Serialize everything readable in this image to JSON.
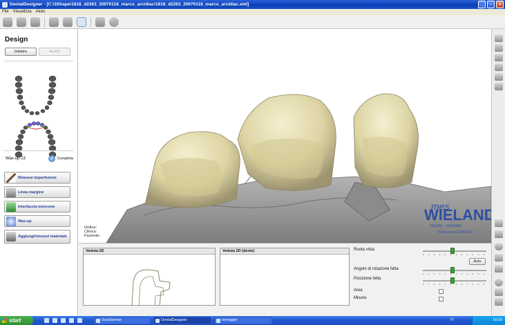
{
  "window": {
    "title": "DentalDesigner - [C:\\3Shape\\1818_d2263_20070118_marco_arcidiac\\1818_d2263_20070118_marco_arcidiac.xml]",
    "buttons": [
      "_",
      "▫",
      "×"
    ]
  },
  "menu": [
    "File",
    "Visualizza",
    "Aiuto"
  ],
  "left_panel": {
    "title": "Design",
    "back_label": "Indietro",
    "next_label": "Avanti",
    "tooth_label": "Wax-up 23",
    "complete_label": "Completa",
    "steps": [
      {
        "label": "Rimuovi imperfezioni"
      },
      {
        "label": "Linea margine"
      },
      {
        "label": "Interfaccia moncone"
      },
      {
        "label": "Wax-up"
      },
      {
        "label": "Aggiungi/rimuovi materiale"
      }
    ]
  },
  "viewport": {
    "info": [
      "Ordine:",
      "Clinica:",
      "Paziente:"
    ],
    "watermark": {
      "brand": "WIELAND",
      "prefix": "mes",
      "tagline": "DENTAL · CERAMIC",
      "sub": "Produzione CAD/CAM"
    }
  },
  "bottom": {
    "view2d_title": "Veduta 2D",
    "view2d_antag_title": "Veduta 2D (dente)",
    "controls": {
      "rotate_label": "Ruota vista",
      "auto_label": "Auto",
      "angle_label": "Angolo di rotazione fetta",
      "position_label": "Posizione fetta",
      "area_label": "Area",
      "measure_label": "Misura"
    }
  },
  "taskbar": {
    "start_label": "start",
    "tasks": [
      "ScanServer",
      "DentalDesigner",
      "Immagini"
    ],
    "lang": "IT",
    "clock": "19:16"
  },
  "colors": {
    "accent": "#233e9a",
    "titlebar": "#0a3fb8",
    "tooth": "#e8e1b8",
    "gum": "#9a9a9a"
  }
}
